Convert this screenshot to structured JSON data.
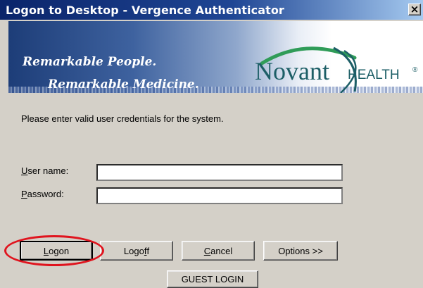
{
  "window": {
    "title": "Logon to Desktop - Vergence Authenticator",
    "close_label": "×"
  },
  "banner": {
    "tagline_line1": "Remarkable People.",
    "tagline_line2": "Remarkable Medicine.",
    "logo_novant": "Novant",
    "logo_health": "HEALTH",
    "logo_reg": "®"
  },
  "form": {
    "instructions": "Please enter valid user credentials for the system.",
    "username": {
      "label_accel": "U",
      "label_rest": "ser name:",
      "value": ""
    },
    "password": {
      "label_accel": "P",
      "label_rest": "assword:",
      "value": ""
    }
  },
  "buttons": {
    "logon": {
      "accel": "L",
      "rest": "ogon"
    },
    "logoff": {
      "pre": "Logo",
      "accel": "f",
      "post": "f"
    },
    "cancel": {
      "accel": "C",
      "rest": "ancel"
    },
    "options": "Options >>",
    "guest": "GUEST LOGIN"
  },
  "colors": {
    "highlight_circle": "#e0141e",
    "titlebar_start": "#0a246a",
    "logo": "#1c5e66"
  }
}
